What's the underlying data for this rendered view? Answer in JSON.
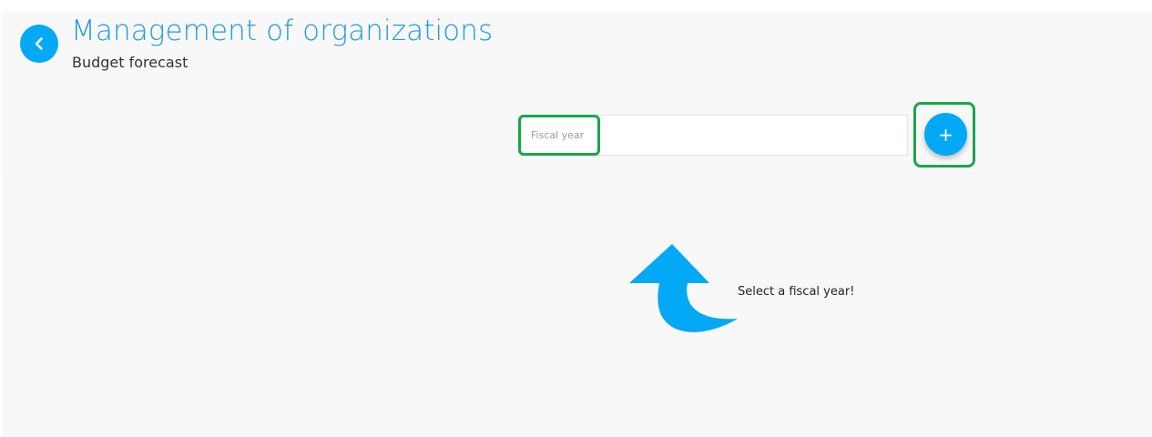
{
  "header": {
    "title": "Management of organizations",
    "subtitle": "Budget forecast",
    "back_icon": "chevron-left-icon"
  },
  "fiscal_year": {
    "placeholder": "Fiscal year",
    "value": ""
  },
  "add_button": {
    "label": "+"
  },
  "empty_state": {
    "message": "Select a fiscal year!",
    "icon": "curved-arrow-up-icon"
  },
  "colors": {
    "accent": "#03a9f4",
    "title": "#1e9be0",
    "highlight": "#1aa64a",
    "background": "#f8f8f8"
  }
}
